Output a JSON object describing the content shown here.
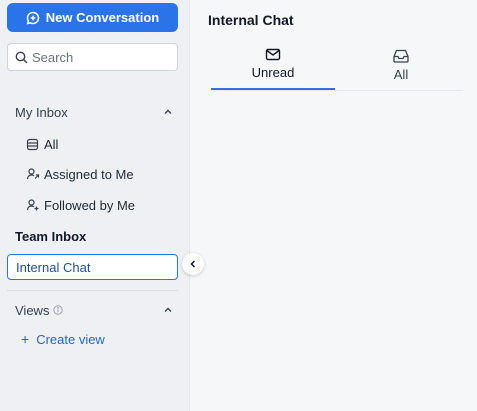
{
  "sidebar": {
    "new_conversation_label": "New Conversation",
    "search": {
      "placeholder": "Search",
      "value": ""
    },
    "my_inbox": {
      "label": "My Inbox",
      "items": [
        {
          "label": "All",
          "icon": "list-icon"
        },
        {
          "label": "Assigned to Me",
          "icon": "user-assigned-icon"
        },
        {
          "label": "Followed by Me",
          "icon": "user-follow-icon"
        }
      ]
    },
    "team_inbox": {
      "label": "Team Inbox",
      "items": [
        {
          "label": "Internal Chat",
          "selected": true
        }
      ]
    },
    "views": {
      "label": "Views",
      "create_label": "Create view"
    }
  },
  "main": {
    "title": "Internal Chat",
    "tabs": [
      {
        "label": "Unread",
        "icon": "envelope-icon",
        "active": true
      },
      {
        "label": "All",
        "icon": "inbox-tray-icon",
        "active": false
      }
    ]
  },
  "colors": {
    "accent": "#2b73e8",
    "sidebar_bg": "#eef0f3",
    "main_bg": "#f6f7f9",
    "link": "#2466c9"
  }
}
